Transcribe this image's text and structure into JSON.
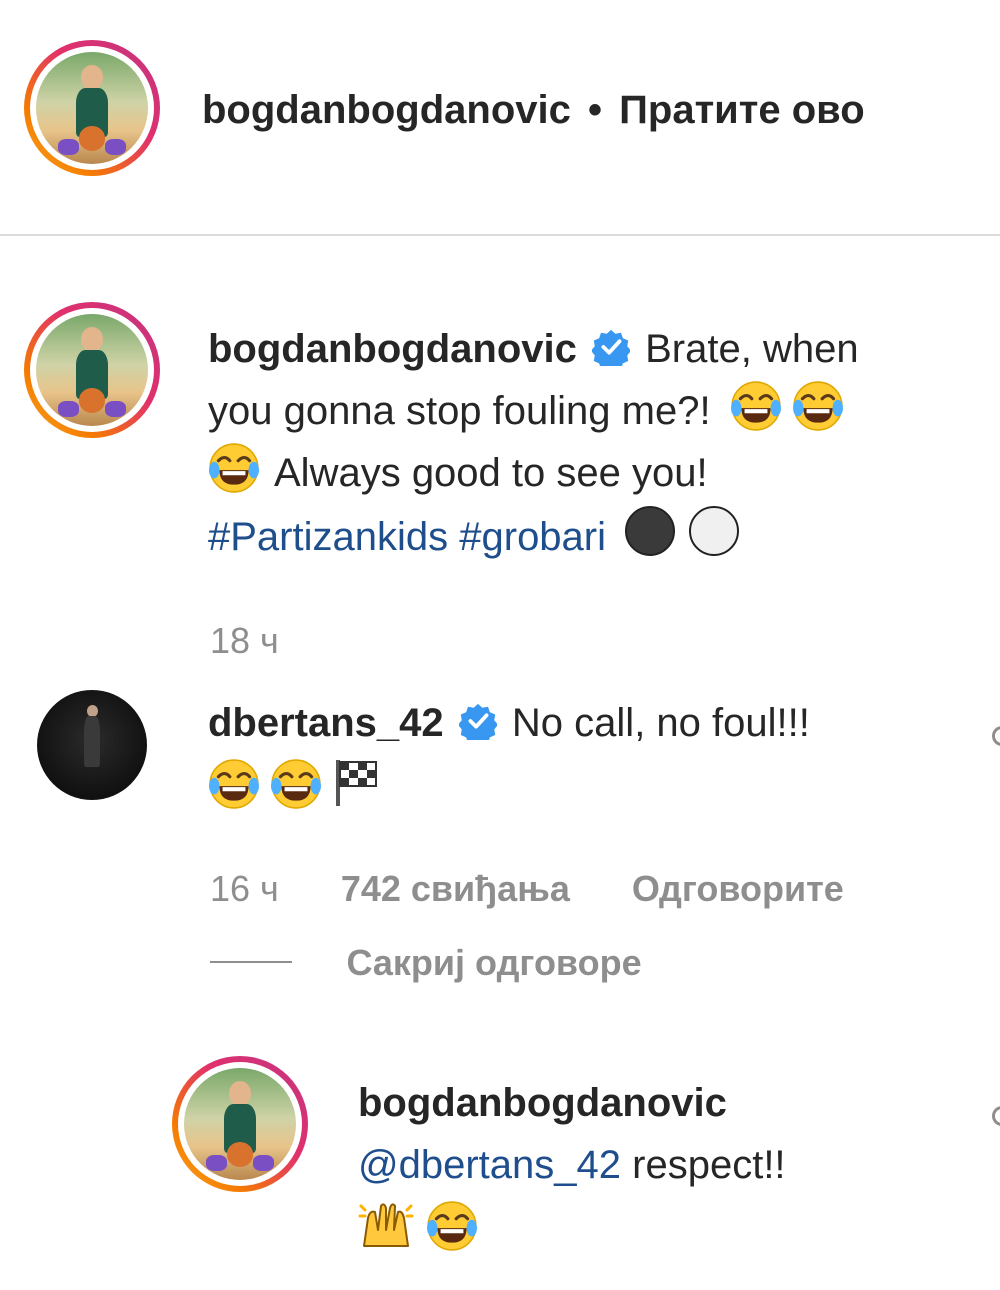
{
  "header": {
    "username": "bogdanbogdanovic",
    "separator": "•",
    "follow_label": "Пратите ово"
  },
  "post": {
    "username": "bogdanbogdanovic",
    "caption_line1_end": "Brate, when",
    "caption_line2": "you gonna stop fouling me?!",
    "caption_line3": "Always good to see you!",
    "hashtag1": "#Partizankids",
    "hashtag2": "#grobari",
    "time": "18 ч"
  },
  "comment": {
    "username": "dbertans_42",
    "text": "No call, no foul!!!",
    "time": "16 ч",
    "likes": "742 свиђања",
    "reply_label": "Одговорите",
    "hide_replies_label": "Сакриј одговоре"
  },
  "reply": {
    "username": "bogdanbogdanovic",
    "mention": "@dbertans_42",
    "text": "respect!!"
  },
  "colors": {
    "verified": "#3897f0",
    "link": "#1f4e8c",
    "muted": "#8e8e8e",
    "divider": "#dbdbdb"
  },
  "icons": [
    "verified-badge-icon",
    "tears-of-joy-emoji",
    "black-circle-emoji",
    "white-circle-emoji",
    "checkered-flag-emoji",
    "raising-hands-emoji"
  ]
}
